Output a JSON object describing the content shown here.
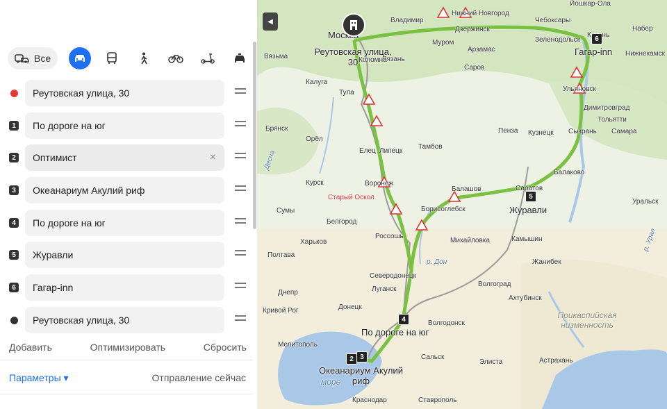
{
  "modes": {
    "all_label": "Все",
    "items": [
      "car",
      "bus",
      "walk",
      "bike",
      "scooter",
      "taxi"
    ]
  },
  "route": {
    "points": [
      {
        "marker": "",
        "value": "Реутовская улица, 30",
        "marker_color": "#e53935"
      },
      {
        "marker": "1",
        "value": "По дороге на юг"
      },
      {
        "marker": "2",
        "value": "Оптимист"
      },
      {
        "marker": "3",
        "value": "Океанариум Акулий риф"
      },
      {
        "marker": "4",
        "value": "По дороге на юг"
      },
      {
        "marker": "5",
        "value": "Журавли"
      },
      {
        "marker": "6",
        "value": "Гагар-inn"
      },
      {
        "marker": "",
        "value": "Реутовская улица, 30",
        "marker_color": "#333333"
      }
    ],
    "clear_glyph": "×"
  },
  "actions": {
    "add": "Добавить",
    "optimize": "Оптимизировать",
    "reset": "Сбросить"
  },
  "footer": {
    "params": "Параметры ▾",
    "depart": "Отправление сейчас"
  },
  "map": {
    "collapse_glyph": "◀",
    "colors": {
      "route": "#7ac142",
      "land": "#eaf0e0",
      "water": "#a9c8e8",
      "forest": "#cfe3b4"
    },
    "cities": {
      "moscow": "Москва",
      "vladimir": "Владимир",
      "nnovgorod": "Нижний Новгород",
      "dzerzhinsk": "Дзержинск",
      "cheboksary": "Чебоксары",
      "zelenodolsk": "Зеленодольск",
      "yoshkar": "Йошкар-Ола",
      "kazan": "Казань",
      "murom": "Муром",
      "arzamas": "Арзамас",
      "ryazan": "Рязань",
      "kolomna": "Коломна",
      "kaluga": "Калуга",
      "vyazma": "Вязьма",
      "tula": "Тула",
      "sarov": "Саров",
      "ulyanovsk": "Ульяновск",
      "dimitrovgrad": "Димитровград",
      "tolyatti": "Тольятти",
      "syzran": "Сызрань",
      "samara": "Самара",
      "kuznetsk": "Кузнецк",
      "penza": "Пенза",
      "bryansk": "Брянск",
      "orel": "Орёл",
      "elets": "Елец",
      "lipetsk": "Липецк",
      "tambov": "Тамбов",
      "kursk": "Курск",
      "voronezh": "Воронеж",
      "staryoskol": "Старый Оскол",
      "balashov": "Балашов",
      "saratov": "Саратов",
      "balakovo": "Балаково",
      "uralsk": "Уральск",
      "sumy": "Сумы",
      "belgorod": "Белгород",
      "borisoglebsk": "Борисоглебск",
      "kharkov": "Харьков",
      "rossosh": "Россошь",
      "mikhailovka": "Михайловка",
      "kamyshin": "Камышин",
      "poltava": "Полтава",
      "severodonetsk": "Северодонецк",
      "lugansk": "Луганск",
      "volgograd": "Волгоград",
      "dnepr": "Днепр",
      "donetsk": "Донецк",
      "akhtubinsk": "Ахтубинск",
      "volgodonsk": "Волгодонск",
      "krivoyrog": "Кривой Рог",
      "melitopol": "Мелитополь",
      "salsk": "Сальск",
      "elista": "Элиста",
      "astrakhan": "Астрахань",
      "krasnodar": "Краснодар",
      "stavropol": "Ставрополь",
      "dzhanibek": "Жанибек",
      "chapaevsk": "Нижнекамск",
      "naberezhnye": "Набер"
    },
    "regions": {
      "caspian": "Прикаспийская низменность",
      "sea": "море",
      "don": "р. Дон",
      "volga": "р. Урал",
      "desna": "Десна"
    },
    "places": {
      "reutov": "Реутовская улица, 30",
      "gagar": "Гагар-inn",
      "zhuravli": "Журавли",
      "south": "По дороге на юг",
      "okeanarium": "Океанариум Акулий риф"
    }
  }
}
